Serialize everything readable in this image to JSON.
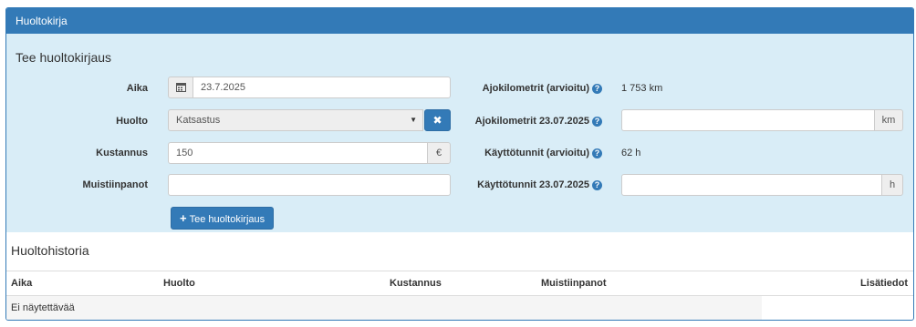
{
  "panel": {
    "title": "Huoltokirja"
  },
  "form": {
    "title": "Tee huoltokirjaus",
    "time": {
      "label": "Aika",
      "value": "23.7.2025",
      "icon": "calendar-icon"
    },
    "service": {
      "label": "Huolto",
      "value": "Katsastus",
      "clear_icon": "times-icon"
    },
    "cost": {
      "label": "Kustannus",
      "value": "150",
      "unit": "€"
    },
    "notes": {
      "label": "Muistiinpanot",
      "value": ""
    },
    "submit_label": "Tee huoltokirjaus",
    "km_estimate": {
      "label": "Ajokilometrit (arvioitu)",
      "value": "1 753 km"
    },
    "km_date": {
      "label": "Ajokilometrit 23.07.2025",
      "value": "",
      "unit": "km"
    },
    "hours_estimate": {
      "label": "Käyttötunnit (arvioitu)",
      "value": "62 h"
    },
    "hours_date": {
      "label": "Käyttötunnit 23.07.2025",
      "value": "",
      "unit": "h"
    }
  },
  "history": {
    "title": "Huoltohistoria",
    "columns": [
      "Aika",
      "Huolto",
      "Kustannus",
      "Muistiinpanot",
      "Lisätiedot"
    ],
    "empty_text": "Ei näytettävää"
  },
  "colors": {
    "primary": "#337ab7",
    "form_bg": "#d9edf7"
  }
}
